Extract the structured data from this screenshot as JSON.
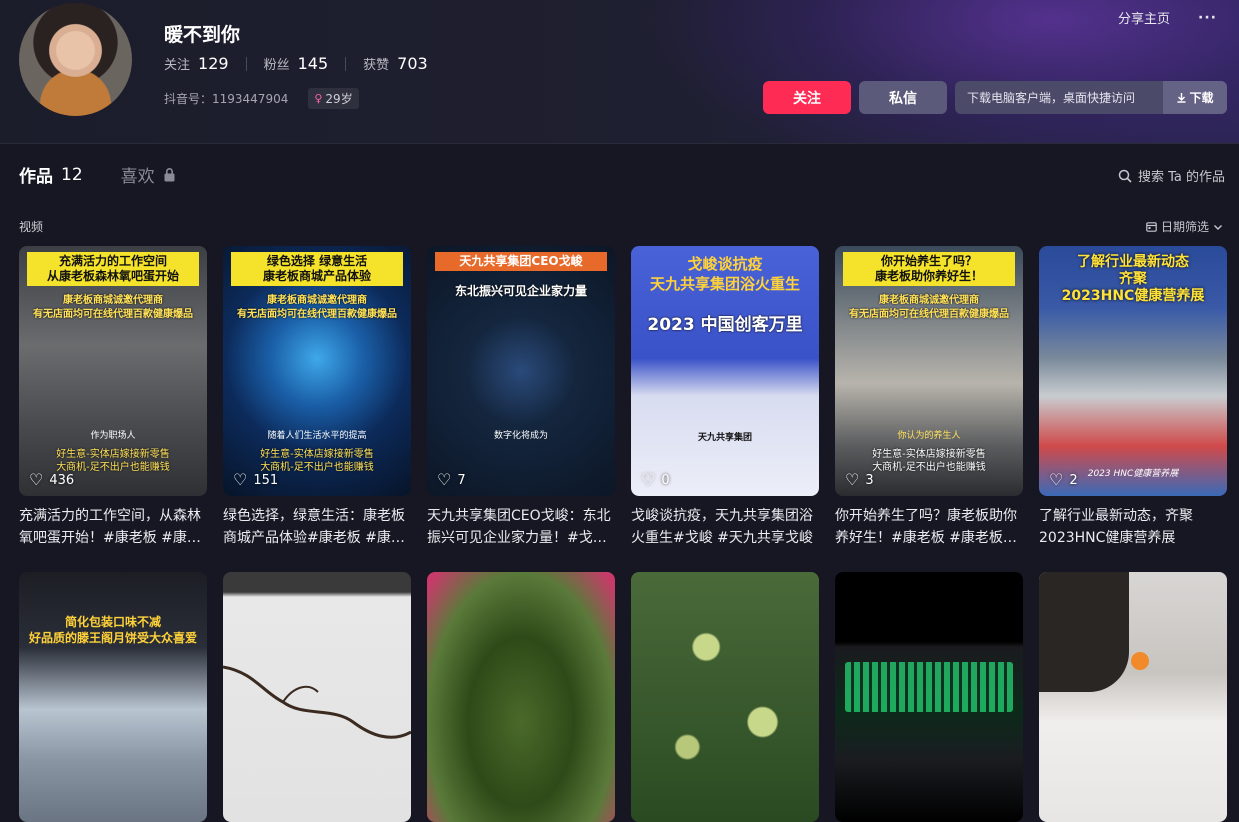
{
  "profile": {
    "nickname": "暖不到你",
    "following_label": "关注",
    "following": "129",
    "fans_label": "粉丝",
    "fans": "145",
    "likes_label": "获赞",
    "likes": "703",
    "douyin_id": "抖音号：1193447904",
    "age": "29岁"
  },
  "header": {
    "share": "分享主页",
    "more": "···",
    "follow": "关注",
    "message": "私信",
    "download_text": "下载电脑客户端，桌面快捷访问",
    "download_btn": "下载"
  },
  "tabs": {
    "works_label": "作品",
    "works_count": "12",
    "likes_label": "喜欢",
    "search": "搜索 Ta 的作品"
  },
  "section": {
    "label": "视频",
    "date_filter": "日期筛选"
  },
  "videos": [
    {
      "likes": "436",
      "desc": "充满活力的工作空间，从森林氧吧蛋开始！#康老板 #康…",
      "cap_top": "充满活力的工作空间\n从康老板森林氧吧蛋开始",
      "cap_mid": "康老板商城诚邀代理商\n有无店面均可在线代理百款健康爆品",
      "cap_small": "作为职场人",
      "cap_bot": "好生意-实体店嫁接新零售\n大商机-足不出户也能赚钱"
    },
    {
      "likes": "151",
      "desc": "绿色选择，绿意生活：康老板商城产品体验#康老板 #康…",
      "cap_top": "绿色选择  绿意生活\n康老板商城产品体验",
      "cap_mid": "康老板商城诚邀代理商\n有无店面均可在线代理百款健康爆品",
      "cap_small": "随着人们生活水平的提高",
      "cap_bot": "好生意-实体店嫁接新零售\n大商机-足不出户也能赚钱"
    },
    {
      "likes": "7",
      "desc": "天九共享集团CEO戈峻：东北振兴可见企业家力量！#戈…",
      "cap_top": "天九共享集团CEO戈峻",
      "cap_mid": "东北振兴可见企业家力量",
      "cap_small": "数字化将成为",
      "cap_bot": ""
    },
    {
      "likes": "0",
      "desc": "戈峻谈抗疫，天九共享集团浴火重生#戈峻 #天九共享戈峻",
      "cap_top": "戈峻谈抗疫\n天九共享集团浴火重生",
      "cap_mid": "2023 中国创客万里",
      "cap_small": "天九共享集团",
      "cap_bot": ""
    },
    {
      "likes": "3",
      "desc": "你开始养生了吗？康老板助你养好生！#康老板 #康老板…",
      "cap_top": "你开始养生了吗？\n康老板助你养好生！",
      "cap_mid": "康老板商城诚邀代理商\n有无店面均可在线代理百款健康爆品",
      "cap_small": "你认为的养生人",
      "cap_bot": "好生意-实体店嫁接新零售\n大商机-足不出户也能赚钱"
    },
    {
      "likes": "2",
      "desc": "了解行业最新动态，齐聚2023HNC健康营养展",
      "cap_top": "了解行业最新动态\n齐聚\n2023HNC健康营养展",
      "cap_mid": "",
      "cap_small": "2023 HNC健康营养展",
      "cap_bot": ""
    },
    {
      "likes": "",
      "desc": "",
      "cap_top": "简化包装口味不减\n好品质的滕王阁月饼受大众喜爱",
      "cap_mid": "",
      "cap_small": "",
      "cap_bot": ""
    },
    {
      "likes": "",
      "desc": "",
      "cap_top": "",
      "cap_mid": "",
      "cap_small": "",
      "cap_bot": ""
    },
    {
      "likes": "",
      "desc": "",
      "cap_top": "",
      "cap_mid": "",
      "cap_small": "",
      "cap_bot": ""
    },
    {
      "likes": "",
      "desc": "",
      "cap_top": "",
      "cap_mid": "",
      "cap_small": "",
      "cap_bot": ""
    },
    {
      "likes": "",
      "desc": "",
      "cap_top": "",
      "cap_mid": "",
      "cap_small": "",
      "cap_bot": ""
    },
    {
      "likes": "",
      "desc": "",
      "cap_top": "",
      "cap_mid": "",
      "cap_small": "",
      "cap_bot": ""
    }
  ],
  "colors": {
    "accent": "#fe2c55",
    "bg": "#161722",
    "message_btn": "#5c5a7a"
  }
}
